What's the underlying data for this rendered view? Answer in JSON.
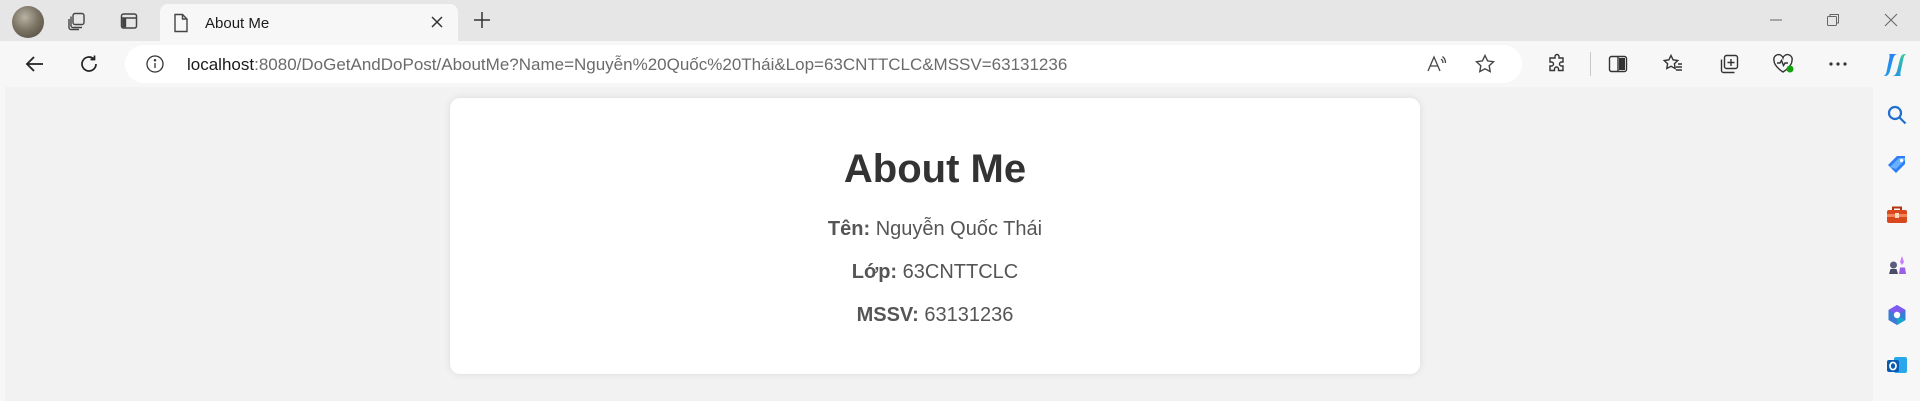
{
  "browser": {
    "tab": {
      "title": "About Me"
    },
    "address": {
      "host": "localhost",
      "rest": ":8080/DoGetAndDoPost/AboutMe?Name=Nguyễn%20Quốc%20Thái&Lop=63CNTTCLC&MSSV=63131236"
    },
    "accent_color": "#0078d4"
  },
  "page": {
    "heading": "About Me",
    "fields": [
      {
        "label": "Tên:",
        "value": "Nguyễn Quốc Thái"
      },
      {
        "label": "Lớp:",
        "value": "63CNTTCLC"
      },
      {
        "label": "MSSV:",
        "value": "63131236"
      }
    ]
  },
  "icons": {
    "tabstrip": [
      "profile-avatar",
      "workspaces-icon",
      "vertical-tabs-icon",
      "document-icon",
      "close-icon",
      "new-tab-icon",
      "minimize-icon",
      "restore-icon",
      "window-close-icon"
    ],
    "toolbar": [
      "back-icon",
      "refresh-icon",
      "info-icon",
      "read-aloud-icon",
      "favorite-star-icon",
      "extensions-icon",
      "split-screen-icon",
      "favorites-icon",
      "collections-icon",
      "browser-essentials-icon",
      "more-icon",
      "copilot-icon"
    ],
    "sidebar": [
      "search-icon",
      "shopping-tag-icon",
      "tools-icon",
      "games-icon",
      "microsoft-365-icon",
      "outlook-icon"
    ]
  }
}
